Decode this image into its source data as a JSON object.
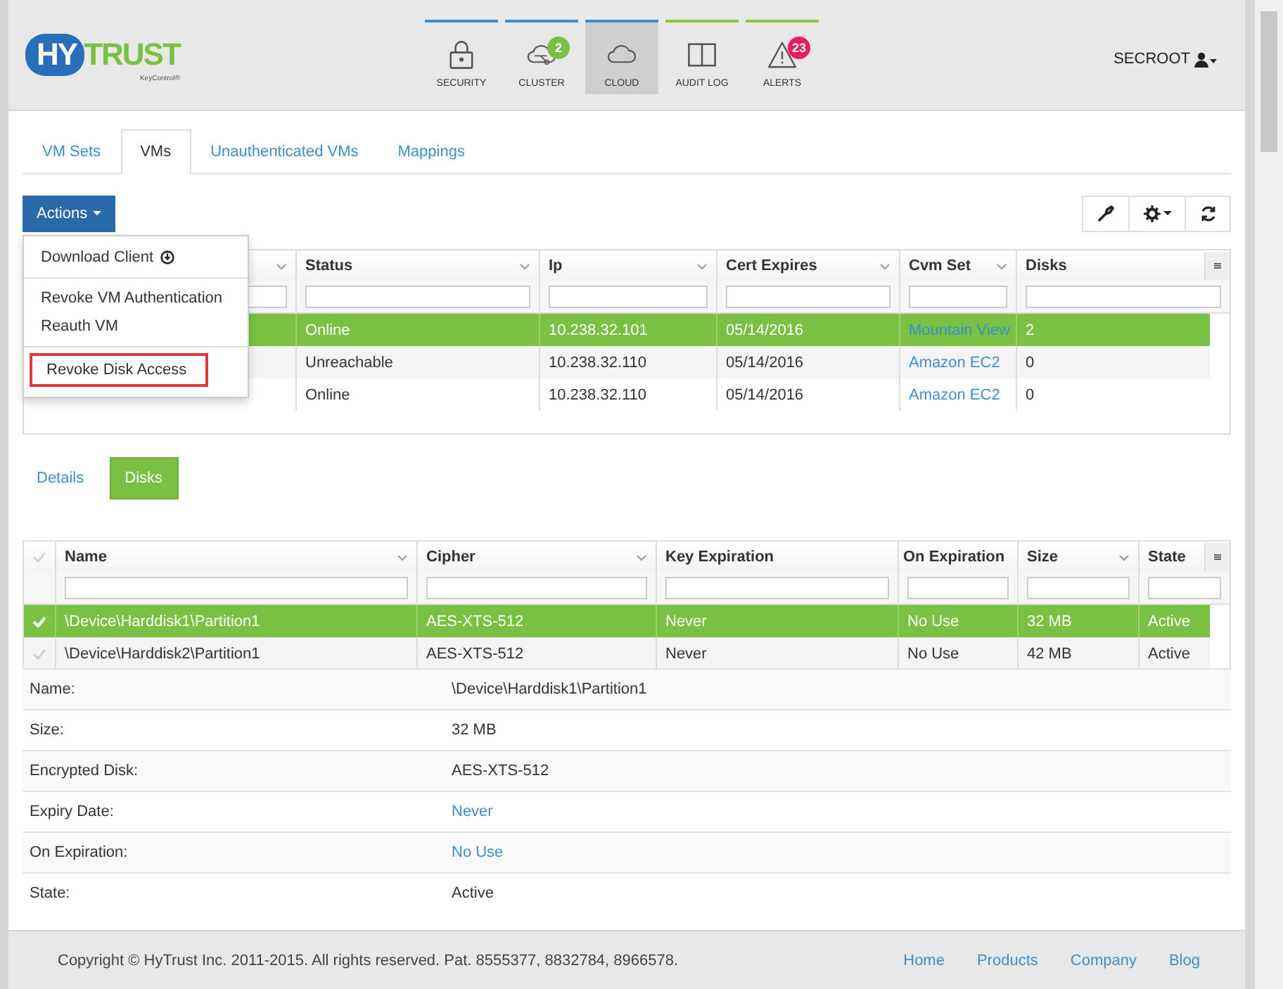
{
  "header": {
    "logo": {
      "left": "HY",
      "right": "TRUST",
      "sub": "KeyControl®"
    },
    "nav": [
      {
        "label": "SECURITY",
        "selected": false
      },
      {
        "label": "CLUSTER",
        "selected": false,
        "badge": "2"
      },
      {
        "label": "CLOUD",
        "selected": true
      },
      {
        "label": "AUDIT LOG",
        "selected": false
      },
      {
        "label": "ALERTS",
        "selected": false,
        "badge": "23"
      }
    ],
    "user": "SECROOT"
  },
  "tabs": [
    {
      "label": "VM Sets",
      "selected": false
    },
    {
      "label": "VMs",
      "selected": true
    },
    {
      "label": "Unauthenticated VMs",
      "selected": false
    },
    {
      "label": "Mappings",
      "selected": false
    }
  ],
  "actions": {
    "label": "Actions",
    "menu": [
      [
        {
          "label": "Download Client",
          "highlighted": false
        }
      ],
      [
        {
          "label": "Revoke VM Authentication",
          "highlighted": false
        },
        {
          "label": "Reauth VM",
          "highlighted": false
        }
      ],
      [
        {
          "label": "Revoke Disk Access",
          "highlighted": true
        }
      ]
    ]
  },
  "vm_table": {
    "columns": [
      "Status",
      "Ip",
      "Cert Expires",
      "Cvm Set",
      "Disks"
    ],
    "rows": [
      {
        "selected": true,
        "status": "Online",
        "ip": "10.238.32.101",
        "cert_expires": "05/14/2016",
        "cvm_set": "Mountain View",
        "disks": "2"
      },
      {
        "selected": false,
        "status": "Unreachable",
        "ip": "10.238.32.110",
        "cert_expires": "05/14/2016",
        "cvm_set": "Amazon EC2",
        "disks": "0"
      },
      {
        "selected": false,
        "status": "Online",
        "ip": "10.238.32.110",
        "cert_expires": "05/14/2016",
        "cvm_set": "Amazon EC2",
        "disks": "0"
      }
    ]
  },
  "detail_tabs": [
    {
      "label": "Details",
      "selected": false
    },
    {
      "label": "Disks",
      "selected": true
    }
  ],
  "disk_table": {
    "columns": [
      "Name",
      "Cipher",
      "Key Expiration",
      "On Expiration",
      "Size",
      "State"
    ],
    "rows": [
      {
        "selected": true,
        "cells": [
          "\\Device\\Harddisk1\\Partition1",
          "AES-XTS-512",
          "Never",
          "No Use",
          "32 MB",
          "Active"
        ]
      },
      {
        "selected": false,
        "cells": [
          "\\Device\\Harddisk2\\Partition1",
          "AES-XTS-512",
          "Never",
          "No Use",
          "42 MB",
          "Active"
        ]
      }
    ]
  },
  "details": [
    {
      "label": "Name:",
      "value": "\\Device\\Harddisk1\\Partition1",
      "link": false
    },
    {
      "label": "Size:",
      "value": "32 MB",
      "link": false
    },
    {
      "label": "Encrypted Disk:",
      "value": "AES-XTS-512",
      "link": false
    },
    {
      "label": "Expiry Date:",
      "value": "Never",
      "link": true
    },
    {
      "label": "On Expiration:",
      "value": "No Use",
      "link": true
    },
    {
      "label": "State:",
      "value": "Active",
      "link": false
    }
  ],
  "footer": {
    "copyright": "Copyright © HyTrust Inc. 2011-2015. All rights reserved. Pat. 8555377, 8832784, 8966578.",
    "links": [
      "Home",
      "Products",
      "Company",
      "Blog"
    ]
  }
}
